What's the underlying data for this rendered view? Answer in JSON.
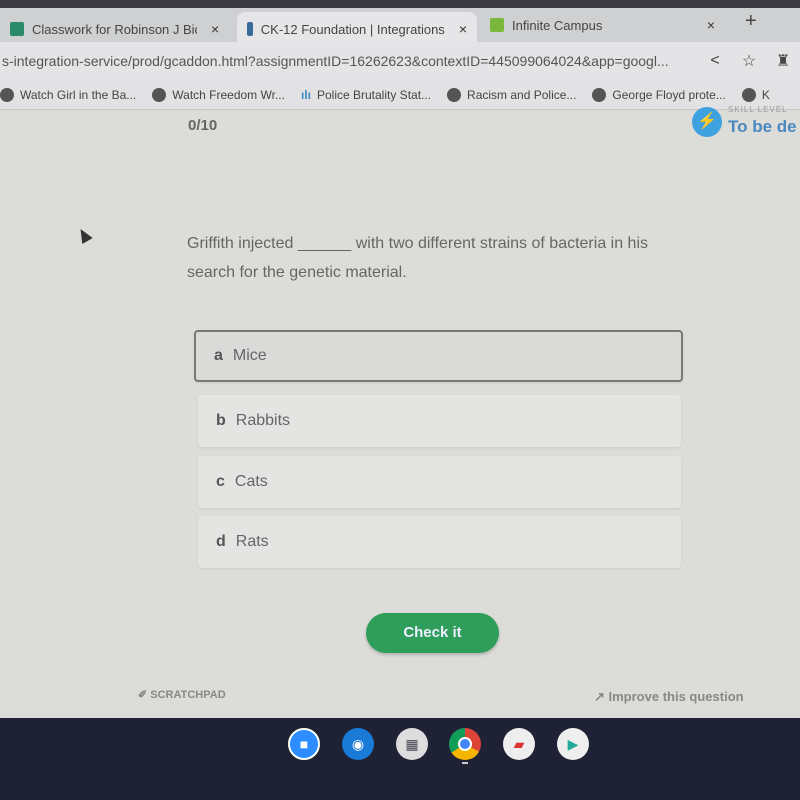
{
  "browser": {
    "tabs": [
      {
        "label": "Classwork for Robinson J Biolo",
        "icon": "classroom-icon",
        "color": "#2a8a6a"
      },
      {
        "label": "CK-12 Foundation | Integrations",
        "icon": "book-icon",
        "color": "#3a6a9a"
      },
      {
        "label": "Infinite Campus",
        "icon": "campus-icon",
        "color": "#7ab83a"
      }
    ],
    "close": "×",
    "new_tab": "+",
    "url": "s-integration-service/prod/gcaddon.html?assignmentID=16262623&contextID=445099064024&app=googl...",
    "bookmarks": [
      {
        "label": "Watch Girl in the Ba..."
      },
      {
        "label": "Watch Freedom Wr..."
      },
      {
        "label": "Police Brutality Stat..."
      },
      {
        "label": "Racism and Police..."
      },
      {
        "label": "George Floyd prote..."
      },
      {
        "label": "K"
      }
    ]
  },
  "quiz": {
    "score": "0/10",
    "skill_label": "SKILL LEVEL",
    "skill_value": "To be de",
    "question_part1": "Griffith injected",
    "blank": "______",
    "question_part2": "with two different strains of bacteria in his search for the genetic material.",
    "options": [
      {
        "letter": "a",
        "text": "Mice",
        "selected": true
      },
      {
        "letter": "b",
        "text": "Rabbits",
        "selected": false
      },
      {
        "letter": "c",
        "text": "Cats",
        "selected": false
      },
      {
        "letter": "d",
        "text": "Rats",
        "selected": false
      }
    ],
    "check_label": "Check it",
    "scratchpad": "SCRATCHPAD",
    "improve": "Improve this question"
  },
  "shelf": {
    "apps": [
      "zoom-icon",
      "camera-icon",
      "game-icon",
      "chrome-icon",
      "slides-icon",
      "play-store-icon"
    ]
  }
}
